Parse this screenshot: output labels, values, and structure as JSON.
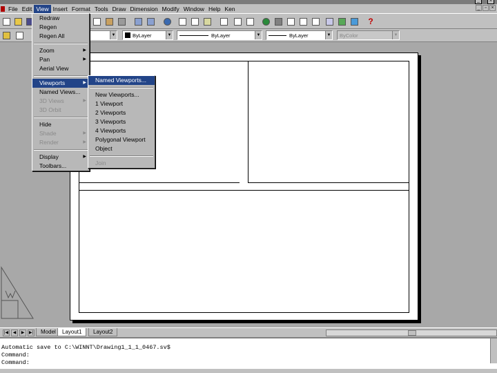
{
  "title_bar": {
    "minimize": "_",
    "close": "x"
  },
  "menubar": {
    "items": [
      "File",
      "Edit",
      "View",
      "Insert",
      "Format",
      "Tools",
      "Draw",
      "Dimension",
      "Modify",
      "Window",
      "Help",
      "Ken"
    ],
    "active": "View"
  },
  "toolbar": {
    "layer_combo": "ByLayer",
    "linetype_combo": "ByLayer",
    "lineweight_combo": "ByLayer",
    "plotstyle_combo": "ByColor"
  },
  "view_menu": {
    "items": [
      {
        "label": "Redraw",
        "submenu": false,
        "disabled": false
      },
      {
        "label": "Regen",
        "submenu": false,
        "disabled": false
      },
      {
        "label": "Regen All",
        "submenu": false,
        "disabled": false
      },
      {
        "sep": true
      },
      {
        "label": "Zoom",
        "submenu": true,
        "disabled": false
      },
      {
        "label": "Pan",
        "submenu": true,
        "disabled": false
      },
      {
        "label": "Aerial View",
        "submenu": false,
        "disabled": false
      },
      {
        "sep": true
      },
      {
        "label": "Viewports",
        "submenu": true,
        "disabled": false,
        "selected": true
      },
      {
        "label": "Named Views...",
        "submenu": false,
        "disabled": false
      },
      {
        "label": "3D Views",
        "submenu": true,
        "disabled": true
      },
      {
        "label": "3D Orbit",
        "submenu": false,
        "disabled": true
      },
      {
        "sep": true
      },
      {
        "label": "Hide",
        "submenu": false,
        "disabled": false
      },
      {
        "label": "Shade",
        "submenu": true,
        "disabled": true
      },
      {
        "label": "Render",
        "submenu": true,
        "disabled": true
      },
      {
        "sep": true
      },
      {
        "label": "Display",
        "submenu": true,
        "disabled": false
      },
      {
        "label": "Toolbars...",
        "submenu": false,
        "disabled": false
      }
    ]
  },
  "viewports_menu": {
    "items": [
      {
        "label": "Named Viewports...",
        "selected": true,
        "disabled": false
      },
      {
        "sep": true
      },
      {
        "label": "New Viewports...",
        "disabled": false
      },
      {
        "label": "1 Viewport",
        "disabled": false
      },
      {
        "label": "2 Viewports",
        "disabled": false
      },
      {
        "label": "3 Viewports",
        "disabled": false
      },
      {
        "label": "4 Viewports",
        "disabled": false
      },
      {
        "label": "Polygonal Viewport",
        "disabled": false
      },
      {
        "label": "Object",
        "disabled": false
      },
      {
        "sep": true
      },
      {
        "label": "Join",
        "disabled": true
      }
    ]
  },
  "layout_tabs": {
    "items": [
      "Model",
      "Layout1",
      "Layout2"
    ],
    "active": "Layout1"
  },
  "command_lines": [
    "Automatic save to C:\\WINNT\\Drawing1_1_1_0467.sv$",
    "Command:",
    "Command:"
  ],
  "colors": {
    "menu_highlight": "#224488",
    "workspace": "#a8a8a8",
    "paper": "#ffffff"
  }
}
